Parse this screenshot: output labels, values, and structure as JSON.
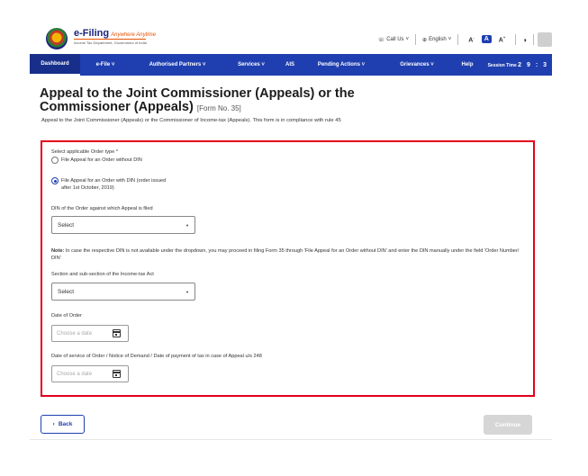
{
  "header": {
    "logo_title": "e-Filing",
    "logo_tag": "Anywhere Anytime",
    "logo_sub": "Income Tax Department, Government of India",
    "call_us": "Call Us",
    "language": "English",
    "font_decrease": "A",
    "font_normal": "A",
    "font_increase": "A",
    "contrast": "◑"
  },
  "nav": {
    "items": [
      "Dashboard",
      "e-File ˅",
      "Authorised Partners ˅",
      "Services ˅",
      "AIS",
      "Pending Actions ˅",
      "Grievances ˅",
      "Help"
    ],
    "session_label": "Session Time",
    "session_time": "2 9 : 3"
  },
  "page": {
    "title": "Appeal to the Joint Commissioner (Appeals) or the Commissioner (Appeals)",
    "form_no": "[Form No. 35]",
    "description": "Appeal to the Joint Commissioner (Appeals) or the Commissioner of Income-tax (Appeals). This form is in compliance with rule 45"
  },
  "form": {
    "order_type_label": "Select applicable Order type *",
    "option_without_din": "File Appeal for an Order without DIN",
    "option_with_din_line1": "File Appeal for an Order with DIN (order issued",
    "option_with_din_line2": "after 1st October, 2019)",
    "din_label": "DIN of the Order against which Appeal is filed",
    "din_select": "Select",
    "note_bold": "Note:",
    "note_text": " In case the respective DIN is not available under the dropdown, you may proceed in filing Form 35 through 'File Appeal for an Order without DIN' and enter the DIN manually under the field 'Order Number/ DIN'",
    "section_label": "Section and sub-section of the Income-tax Act",
    "section_select": "Select",
    "date_of_order_label": "Date of Order",
    "date_placeholder": "Choose a date",
    "date_of_service_label": "Date of service of Order / Notice of Demand / Date of payment of tax in case of Appeal u/s 248",
    "date_placeholder_2": "Choose a date"
  },
  "footer": {
    "back_label": "Back",
    "continue_label": "Continue"
  },
  "colors": {
    "primary": "#1f3fb0",
    "highlight_border": "#e3001b",
    "disabled": "#d6d6d6"
  }
}
